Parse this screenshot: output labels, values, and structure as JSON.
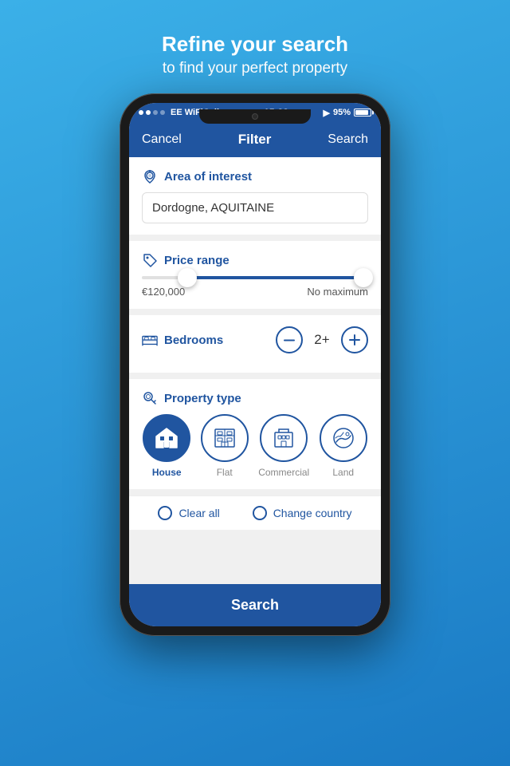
{
  "header": {
    "line1": "Refine your search",
    "line2": "to find your perfect property"
  },
  "statusBar": {
    "carrier": "EE WiFiCall",
    "time": "15:28",
    "battery": "95%"
  },
  "navBar": {
    "cancel": "Cancel",
    "title": "Filter",
    "search": "Search"
  },
  "areaSection": {
    "title": "Area of interest",
    "value": "Dordogne, AQUITAINE"
  },
  "priceSection": {
    "title": "Price range",
    "minLabel": "€120,000",
    "maxLabel": "No maximum"
  },
  "bedroomsSection": {
    "title": "Bedrooms",
    "count": "2+"
  },
  "propertyTypeSection": {
    "title": "Property type",
    "types": [
      {
        "label": "House",
        "active": true
      },
      {
        "label": "Flat",
        "active": false
      },
      {
        "label": "Commercial",
        "active": false
      },
      {
        "label": "Land",
        "active": false
      }
    ]
  },
  "bottomActions": {
    "clearAll": "Clear all",
    "changeCountry": "Change country"
  },
  "searchButton": "Search"
}
